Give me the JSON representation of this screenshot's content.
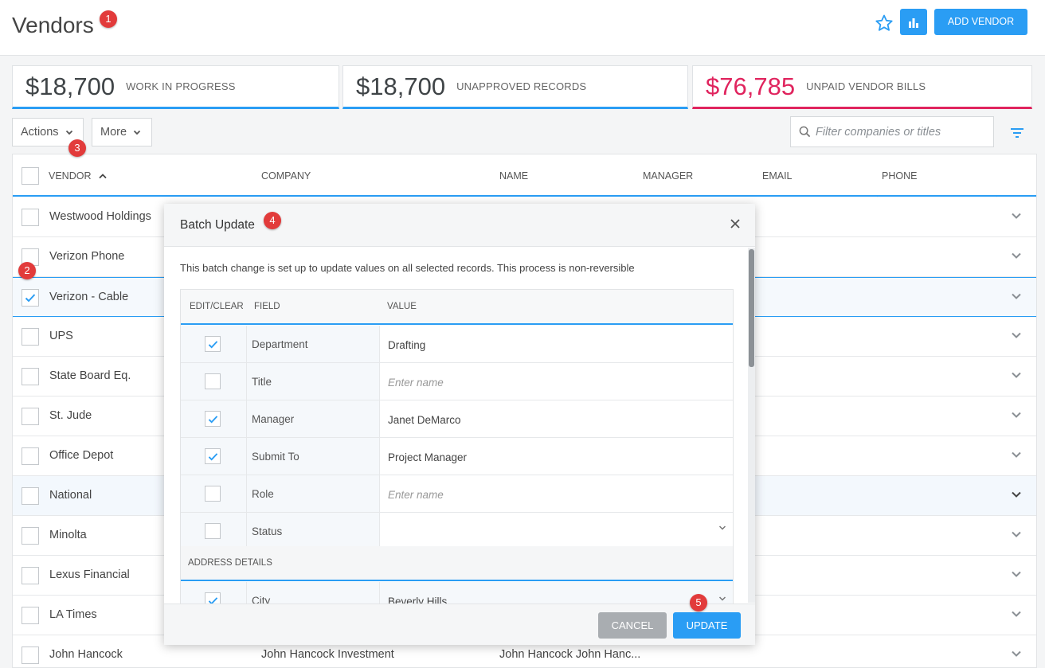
{
  "header": {
    "title": "Vendors",
    "add_vendor_label": "ADD VENDOR"
  },
  "badges": [
    "1",
    "2",
    "3",
    "4",
    "5"
  ],
  "stats": [
    {
      "value": "$18,700",
      "label": "WORK IN PROGRESS"
    },
    {
      "value": "$18,700",
      "label": "UNAPPROVED RECORDS"
    },
    {
      "value": "$76,785",
      "label": "UNPAID VENDOR BILLS",
      "color": "#e0245e"
    }
  ],
  "toolbar": {
    "actions_label": "Actions",
    "more_label": "More",
    "filter_placeholder": "Filter companies or titles"
  },
  "table": {
    "columns": [
      "VENDOR",
      "COMPANY",
      "NAME",
      "MANAGER",
      "EMAIL",
      "PHONE"
    ],
    "rows": [
      {
        "vendor": "Westwood Holdings",
        "company": "",
        "name": "",
        "checked": false
      },
      {
        "vendor": "Verizon Phone",
        "company": "",
        "name": "",
        "checked": false
      },
      {
        "vendor": "Verizon - Cable",
        "company": "",
        "name": "",
        "checked": true
      },
      {
        "vendor": "UPS",
        "company": "",
        "name": "",
        "checked": false
      },
      {
        "vendor": "State Board Eq.",
        "company": "",
        "name": "",
        "checked": false
      },
      {
        "vendor": "St. Jude",
        "company": "",
        "name": "",
        "checked": false
      },
      {
        "vendor": "Office Depot",
        "company": "",
        "name": "",
        "checked": false
      },
      {
        "vendor": "National",
        "company": "",
        "name": "",
        "checked": false
      },
      {
        "vendor": "Minolta",
        "company": "",
        "name": "",
        "checked": false
      },
      {
        "vendor": "Lexus Financial",
        "company": "",
        "name": "",
        "checked": false
      },
      {
        "vendor": "LA Times",
        "company": "",
        "name": "",
        "checked": false
      },
      {
        "vendor": "John Hancock",
        "company": "John Hancock Investment",
        "name": "John Hancock John Hanc...",
        "checked": false
      }
    ]
  },
  "modal": {
    "title": "Batch Update",
    "description": "This batch change is set up to update values on all selected records. This process is non-reversible",
    "columns": [
      "EDIT/CLEAR",
      "FIELD",
      "VALUE"
    ],
    "fields": [
      {
        "field": "Department",
        "value": "Drafting",
        "checked": true,
        "placeholder": false
      },
      {
        "field": "Title",
        "value": "Enter name",
        "checked": false,
        "placeholder": true
      },
      {
        "field": "Manager",
        "value": "Janet DeMarco",
        "checked": true,
        "placeholder": false
      },
      {
        "field": "Submit To",
        "value": "Project Manager",
        "checked": true,
        "placeholder": false
      },
      {
        "field": "Role",
        "value": "Enter name",
        "checked": false,
        "placeholder": true
      },
      {
        "field": "Status",
        "value": "",
        "checked": false,
        "placeholder": false,
        "dropdown": true
      }
    ],
    "section_label": "ADDRESS DETAILS",
    "address_fields": [
      {
        "field": "City",
        "value": "Beverly Hills",
        "checked": true,
        "dropdown": true
      }
    ],
    "cancel_label": "CANCEL",
    "update_label": "UPDATE"
  },
  "colors": {
    "accent": "#2a9df4",
    "alert": "#e0245e",
    "badge": "#e23b3b"
  }
}
